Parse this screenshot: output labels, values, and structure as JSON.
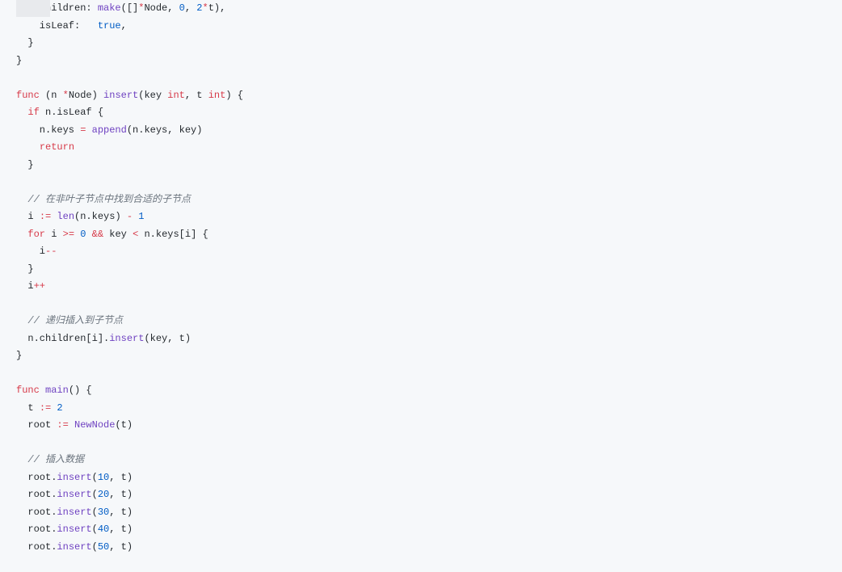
{
  "code": {
    "lines": [
      {
        "i": 0,
        "tokens": [
          {
            "t": "    children: ",
            "c": "ident"
          },
          {
            "t": "make",
            "c": "fn"
          },
          {
            "t": "([]",
            "c": "paren"
          },
          {
            "t": "*",
            "c": "op"
          },
          {
            "t": "Node, ",
            "c": "ident"
          },
          {
            "t": "0",
            "c": "num"
          },
          {
            "t": ", ",
            "c": "ident"
          },
          {
            "t": "2",
            "c": "num"
          },
          {
            "t": "*",
            "c": "op"
          },
          {
            "t": "t),",
            "c": "ident"
          }
        ]
      },
      {
        "i": 1,
        "tokens": [
          {
            "t": "    isLeaf:   ",
            "c": "ident"
          },
          {
            "t": "true",
            "c": "bool"
          },
          {
            "t": ",",
            "c": "ident"
          }
        ]
      },
      {
        "i": 2,
        "tokens": [
          {
            "t": "  }",
            "c": "ident"
          }
        ]
      },
      {
        "i": 3,
        "tokens": [
          {
            "t": "}",
            "c": "ident"
          }
        ]
      },
      {
        "i": 4,
        "tokens": [
          {
            "t": "",
            "c": "ident"
          }
        ]
      },
      {
        "i": 5,
        "tokens": [
          {
            "t": "func",
            "c": "kw"
          },
          {
            "t": " (n ",
            "c": "ident"
          },
          {
            "t": "*",
            "c": "op"
          },
          {
            "t": "Node) ",
            "c": "ident"
          },
          {
            "t": "insert",
            "c": "fn"
          },
          {
            "t": "(key ",
            "c": "ident"
          },
          {
            "t": "int",
            "c": "typ"
          },
          {
            "t": ", t ",
            "c": "ident"
          },
          {
            "t": "int",
            "c": "typ"
          },
          {
            "t": ") {",
            "c": "ident"
          }
        ]
      },
      {
        "i": 6,
        "tokens": [
          {
            "t": "  ",
            "c": "ident"
          },
          {
            "t": "if",
            "c": "kw"
          },
          {
            "t": " n.isLeaf {",
            "c": "ident"
          }
        ]
      },
      {
        "i": 7,
        "tokens": [
          {
            "t": "    n.keys ",
            "c": "ident"
          },
          {
            "t": "=",
            "c": "op"
          },
          {
            "t": " ",
            "c": "ident"
          },
          {
            "t": "append",
            "c": "fn"
          },
          {
            "t": "(n.keys, key)",
            "c": "ident"
          }
        ]
      },
      {
        "i": 8,
        "tokens": [
          {
            "t": "    ",
            "c": "ident"
          },
          {
            "t": "return",
            "c": "kw"
          }
        ]
      },
      {
        "i": 9,
        "tokens": [
          {
            "t": "  }",
            "c": "ident"
          }
        ]
      },
      {
        "i": 10,
        "tokens": [
          {
            "t": "",
            "c": "ident"
          }
        ]
      },
      {
        "i": 11,
        "tokens": [
          {
            "t": "  ",
            "c": "ident"
          },
          {
            "t": "// 在非叶子节点中找到合适的子节点",
            "c": "cmt"
          }
        ]
      },
      {
        "i": 12,
        "tokens": [
          {
            "t": "  i ",
            "c": "ident"
          },
          {
            "t": ":=",
            "c": "op"
          },
          {
            "t": " ",
            "c": "ident"
          },
          {
            "t": "len",
            "c": "fn"
          },
          {
            "t": "(n.keys) ",
            "c": "ident"
          },
          {
            "t": "-",
            "c": "op"
          },
          {
            "t": " ",
            "c": "ident"
          },
          {
            "t": "1",
            "c": "num"
          }
        ]
      },
      {
        "i": 13,
        "tokens": [
          {
            "t": "  ",
            "c": "ident"
          },
          {
            "t": "for",
            "c": "kw"
          },
          {
            "t": " i ",
            "c": "ident"
          },
          {
            "t": ">=",
            "c": "op"
          },
          {
            "t": " ",
            "c": "ident"
          },
          {
            "t": "0",
            "c": "num"
          },
          {
            "t": " ",
            "c": "ident"
          },
          {
            "t": "&&",
            "c": "op"
          },
          {
            "t": " key ",
            "c": "ident"
          },
          {
            "t": "<",
            "c": "op"
          },
          {
            "t": " n.keys[i] {",
            "c": "ident"
          }
        ]
      },
      {
        "i": 14,
        "tokens": [
          {
            "t": "    i",
            "c": "ident"
          },
          {
            "t": "--",
            "c": "op"
          }
        ]
      },
      {
        "i": 15,
        "tokens": [
          {
            "t": "  }",
            "c": "ident"
          }
        ]
      },
      {
        "i": 16,
        "tokens": [
          {
            "t": "  i",
            "c": "ident"
          },
          {
            "t": "++",
            "c": "op"
          }
        ]
      },
      {
        "i": 17,
        "tokens": [
          {
            "t": "",
            "c": "ident"
          }
        ]
      },
      {
        "i": 18,
        "tokens": [
          {
            "t": "  ",
            "c": "ident"
          },
          {
            "t": "// 递归插入到子节点",
            "c": "cmt"
          }
        ]
      },
      {
        "i": 19,
        "tokens": [
          {
            "t": "  n.children[i].",
            "c": "ident"
          },
          {
            "t": "insert",
            "c": "fn"
          },
          {
            "t": "(key, t)",
            "c": "ident"
          }
        ]
      },
      {
        "i": 20,
        "tokens": [
          {
            "t": "}",
            "c": "ident"
          }
        ]
      },
      {
        "i": 21,
        "tokens": [
          {
            "t": "",
            "c": "ident"
          }
        ]
      },
      {
        "i": 22,
        "tokens": [
          {
            "t": "func",
            "c": "kw"
          },
          {
            "t": " ",
            "c": "ident"
          },
          {
            "t": "main",
            "c": "fn"
          },
          {
            "t": "() {",
            "c": "ident"
          }
        ]
      },
      {
        "i": 23,
        "tokens": [
          {
            "t": "  t ",
            "c": "ident"
          },
          {
            "t": ":=",
            "c": "op"
          },
          {
            "t": " ",
            "c": "ident"
          },
          {
            "t": "2",
            "c": "num"
          }
        ]
      },
      {
        "i": 24,
        "tokens": [
          {
            "t": "  root ",
            "c": "ident"
          },
          {
            "t": ":=",
            "c": "op"
          },
          {
            "t": " ",
            "c": "ident"
          },
          {
            "t": "NewNode",
            "c": "fn"
          },
          {
            "t": "(t)",
            "c": "ident"
          }
        ]
      },
      {
        "i": 25,
        "tokens": [
          {
            "t": "",
            "c": "ident"
          }
        ]
      },
      {
        "i": 26,
        "tokens": [
          {
            "t": "  ",
            "c": "ident"
          },
          {
            "t": "// 插入数据",
            "c": "cmt"
          }
        ]
      },
      {
        "i": 27,
        "tokens": [
          {
            "t": "  root.",
            "c": "ident"
          },
          {
            "t": "insert",
            "c": "fn"
          },
          {
            "t": "(",
            "c": "ident"
          },
          {
            "t": "10",
            "c": "num"
          },
          {
            "t": ", t)",
            "c": "ident"
          }
        ]
      },
      {
        "i": 28,
        "tokens": [
          {
            "t": "  root.",
            "c": "ident"
          },
          {
            "t": "insert",
            "c": "fn"
          },
          {
            "t": "(",
            "c": "ident"
          },
          {
            "t": "20",
            "c": "num"
          },
          {
            "t": ", t)",
            "c": "ident"
          }
        ]
      },
      {
        "i": 29,
        "tokens": [
          {
            "t": "  root.",
            "c": "ident"
          },
          {
            "t": "insert",
            "c": "fn"
          },
          {
            "t": "(",
            "c": "ident"
          },
          {
            "t": "30",
            "c": "num"
          },
          {
            "t": ", t)",
            "c": "ident"
          }
        ]
      },
      {
        "i": 30,
        "tokens": [
          {
            "t": "  root.",
            "c": "ident"
          },
          {
            "t": "insert",
            "c": "fn"
          },
          {
            "t": "(",
            "c": "ident"
          },
          {
            "t": "40",
            "c": "num"
          },
          {
            "t": ", t)",
            "c": "ident"
          }
        ]
      },
      {
        "i": 31,
        "tokens": [
          {
            "t": "  root.",
            "c": "ident"
          },
          {
            "t": "insert",
            "c": "fn"
          },
          {
            "t": "(",
            "c": "ident"
          },
          {
            "t": "50",
            "c": "num"
          },
          {
            "t": ", t)",
            "c": "ident"
          }
        ]
      }
    ]
  }
}
